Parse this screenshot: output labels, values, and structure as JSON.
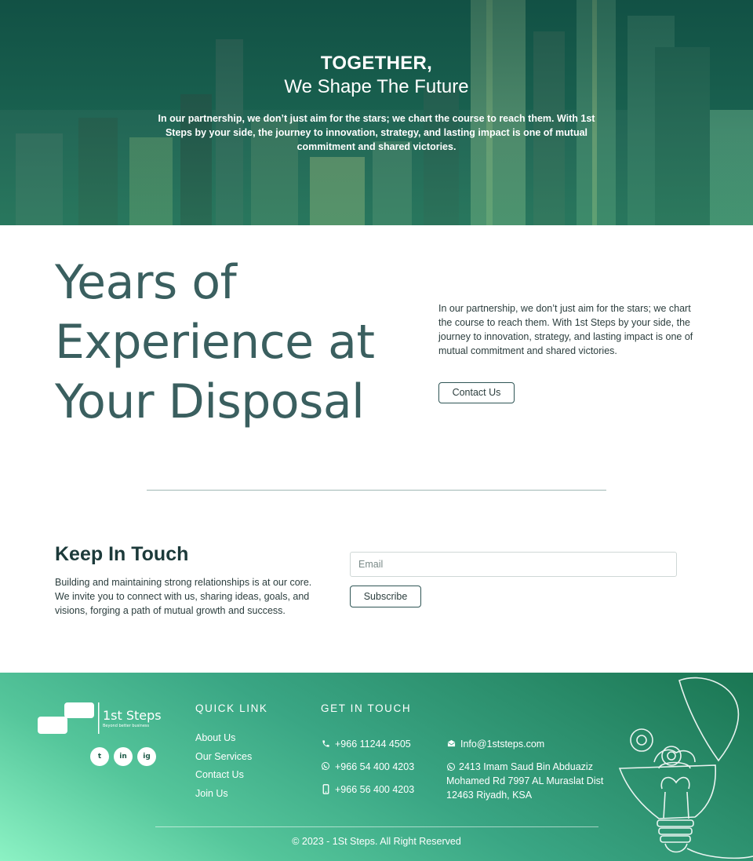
{
  "hero": {
    "title_line1": "TOGETHER,",
    "title_line2": "We Shape The Future",
    "description": "In our partnership, we don’t just aim for the stars; we chart the course to reach them. With 1st Steps by your side, the journey to innovation, strategy, and lasting impact is one of mutual commitment and shared victories."
  },
  "experience": {
    "title": "Years of Experience at Your Disposal",
    "description": "In our partnership, we don’t just aim for the stars; we chart the course to reach them. With 1st Steps by your side, the journey to innovation, strategy, and lasting impact is one of mutual commitment and shared victories.",
    "contact_button": "Contact Us"
  },
  "newsletter": {
    "title": "Keep In Touch",
    "description": "Building and maintaining strong relationships is at our core. We invite you to connect with us, sharing ideas, goals, and visions, forging a path of mutual growth and success.",
    "email_placeholder": "Email",
    "subscribe_button": "Subscribe"
  },
  "footer": {
    "logo": {
      "name": "1st Steps",
      "tagline": "Beyond better business"
    },
    "socials": [
      {
        "name": "twitter-icon",
        "glyph": "t"
      },
      {
        "name": "linkedin-icon",
        "glyph": "in"
      },
      {
        "name": "instagram-icon",
        "glyph": "ig"
      }
    ],
    "quick_link": {
      "heading": "QUICK LINK",
      "items": [
        "About Us",
        "Our Services",
        "Contact Us",
        "Join Us"
      ]
    },
    "get_in_touch": {
      "heading": "GET IN TOUCH",
      "phone": "+966 11244 4505",
      "whatsapp": "+966 54 400 4203",
      "mobile": "+966 56 400 4203",
      "email": "Info@1ststeps.com",
      "address": "2413 Imam Saud Bin Abduaziz Mohamed Rd 7997 AL Muraslat Dist 12463 Riyadh, KSA"
    },
    "copyright": "2023 - 1St Steps. All Right Reserved"
  },
  "colors": {
    "heading_teal": "#3a5f5f",
    "footer_gradient_start": "#8cf2c4",
    "footer_gradient_end": "#1a7552",
    "hero_overlay": "#0f4e43"
  }
}
